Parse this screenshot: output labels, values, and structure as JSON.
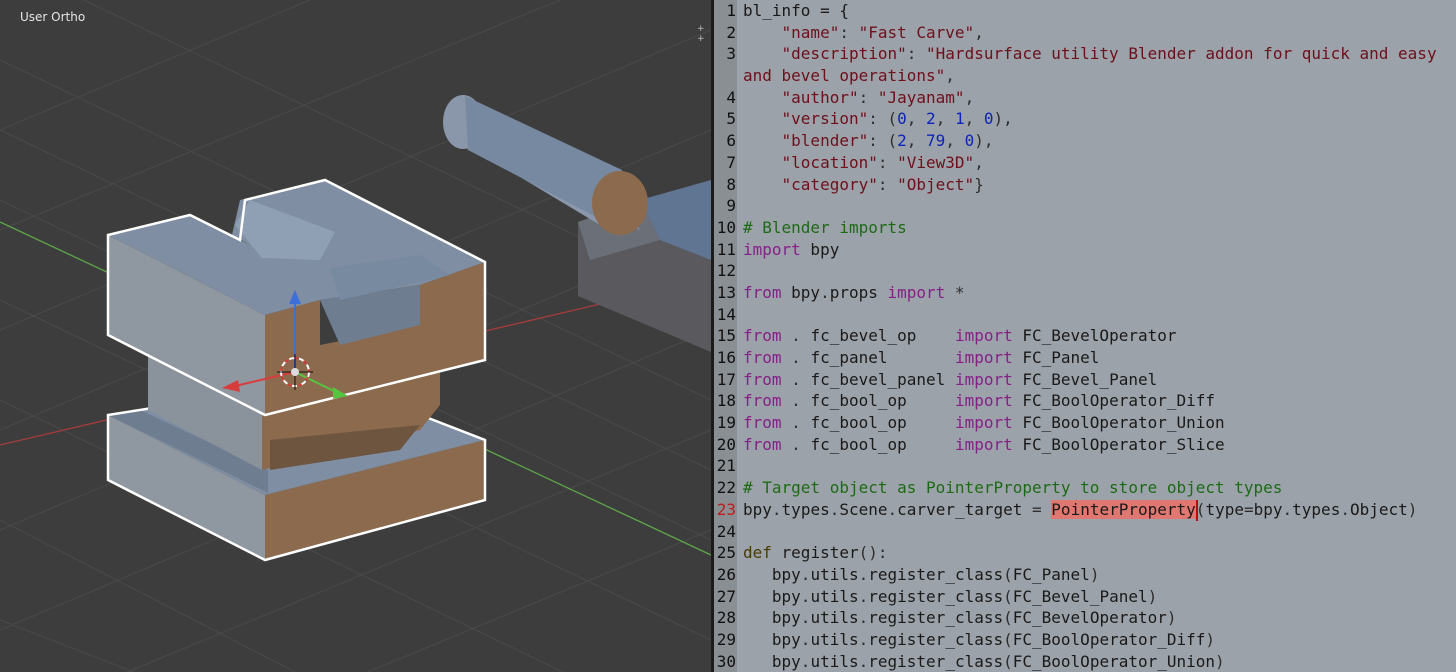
{
  "viewport": {
    "view_label": "User Ortho",
    "split_corner_icons": "+ +",
    "colors": {
      "background": "#3d3d3d",
      "grid": "#4a4a4a",
      "x_axis": "#a53c3c",
      "y_axis": "#5ea64a",
      "selection_outline": "#ffffff",
      "top_face": "#7f8ea3",
      "side_face": "#8c6a4d",
      "front_face": "#9aa3ad"
    }
  },
  "editor": {
    "current_line": 23,
    "lines": [
      {
        "n": "1",
        "tokens": [
          [
            "plain",
            "bl_info = {"
          ]
        ]
      },
      {
        "n": "2",
        "tokens": [
          [
            "plain",
            "    "
          ],
          [
            "str",
            "\"name\""
          ],
          [
            "op",
            ": "
          ],
          [
            "str",
            "\"Fast Carve\""
          ],
          [
            "op",
            ","
          ]
        ]
      },
      {
        "n": "3",
        "tokens": [
          [
            "plain",
            "    "
          ],
          [
            "str",
            "\"description\""
          ],
          [
            "op",
            ": "
          ],
          [
            "str",
            "\"Hardsurface utility Blender addon for quick and easy"
          ]
        ]
      },
      {
        "n": "",
        "tokens": [
          [
            "str",
            "and bevel operations\""
          ],
          [
            "op",
            ","
          ]
        ]
      },
      {
        "n": "4",
        "tokens": [
          [
            "plain",
            "    "
          ],
          [
            "str",
            "\"author\""
          ],
          [
            "op",
            ": "
          ],
          [
            "str",
            "\"Jayanam\""
          ],
          [
            "op",
            ","
          ]
        ]
      },
      {
        "n": "5",
        "tokens": [
          [
            "plain",
            "    "
          ],
          [
            "str",
            "\"version\""
          ],
          [
            "op",
            ": ("
          ],
          [
            "num",
            "0"
          ],
          [
            "op",
            ", "
          ],
          [
            "num",
            "2"
          ],
          [
            "op",
            ", "
          ],
          [
            "num",
            "1"
          ],
          [
            "op",
            ", "
          ],
          [
            "num",
            "0"
          ],
          [
            "op",
            "),"
          ]
        ]
      },
      {
        "n": "6",
        "tokens": [
          [
            "plain",
            "    "
          ],
          [
            "str",
            "\"blender\""
          ],
          [
            "op",
            ": ("
          ],
          [
            "num",
            "2"
          ],
          [
            "op",
            ", "
          ],
          [
            "num",
            "79"
          ],
          [
            "op",
            ", "
          ],
          [
            "num",
            "0"
          ],
          [
            "op",
            "),"
          ]
        ]
      },
      {
        "n": "7",
        "tokens": [
          [
            "plain",
            "    "
          ],
          [
            "str",
            "\"location\""
          ],
          [
            "op",
            ": "
          ],
          [
            "str",
            "\"View3D\""
          ],
          [
            "op",
            ","
          ]
        ]
      },
      {
        "n": "8",
        "tokens": [
          [
            "plain",
            "    "
          ],
          [
            "str",
            "\"category\""
          ],
          [
            "op",
            ": "
          ],
          [
            "str",
            "\"Object\""
          ],
          [
            "op",
            "}"
          ]
        ]
      },
      {
        "n": "9",
        "tokens": []
      },
      {
        "n": "10",
        "tokens": [
          [
            "cmt",
            "# Blender imports"
          ]
        ]
      },
      {
        "n": "11",
        "tokens": [
          [
            "kw",
            "import"
          ],
          [
            "plain",
            " bpy"
          ]
        ]
      },
      {
        "n": "12",
        "tokens": []
      },
      {
        "n": "13",
        "tokens": [
          [
            "kw",
            "from"
          ],
          [
            "plain",
            " bpy"
          ],
          [
            "op",
            "."
          ],
          [
            "plain",
            "props "
          ],
          [
            "kw",
            "import"
          ],
          [
            "op",
            " *"
          ]
        ]
      },
      {
        "n": "14",
        "tokens": []
      },
      {
        "n": "15",
        "tokens": [
          [
            "kw",
            "from"
          ],
          [
            "op",
            " . "
          ],
          [
            "plain",
            "fc_bevel_op    "
          ],
          [
            "kw",
            "import"
          ],
          [
            "plain",
            " FC_BevelOperator"
          ]
        ]
      },
      {
        "n": "16",
        "tokens": [
          [
            "kw",
            "from"
          ],
          [
            "op",
            " . "
          ],
          [
            "plain",
            "fc_panel       "
          ],
          [
            "kw",
            "import"
          ],
          [
            "plain",
            " FC_Panel"
          ]
        ]
      },
      {
        "n": "17",
        "tokens": [
          [
            "kw",
            "from"
          ],
          [
            "op",
            " . "
          ],
          [
            "plain",
            "fc_bevel_panel "
          ],
          [
            "kw",
            "import"
          ],
          [
            "plain",
            " FC_Bevel_Panel"
          ]
        ]
      },
      {
        "n": "18",
        "tokens": [
          [
            "kw",
            "from"
          ],
          [
            "op",
            " . "
          ],
          [
            "plain",
            "fc_bool_op     "
          ],
          [
            "kw",
            "import"
          ],
          [
            "plain",
            " FC_BoolOperator_Diff"
          ]
        ]
      },
      {
        "n": "19",
        "tokens": [
          [
            "kw",
            "from"
          ],
          [
            "op",
            " . "
          ],
          [
            "plain",
            "fc_bool_op     "
          ],
          [
            "kw",
            "import"
          ],
          [
            "plain",
            " FC_BoolOperator_Union"
          ]
        ]
      },
      {
        "n": "20",
        "tokens": [
          [
            "kw",
            "from"
          ],
          [
            "op",
            " . "
          ],
          [
            "plain",
            "fc_bool_op     "
          ],
          [
            "kw",
            "import"
          ],
          [
            "plain",
            " FC_BoolOperator_Slice"
          ]
        ]
      },
      {
        "n": "21",
        "tokens": []
      },
      {
        "n": "22",
        "tokens": [
          [
            "cmt",
            "# Target object as PointerProperty to store object types"
          ]
        ]
      },
      {
        "n": "23",
        "tokens": [
          [
            "plain",
            "bpy"
          ],
          [
            "op",
            "."
          ],
          [
            "plain",
            "types"
          ],
          [
            "op",
            "."
          ],
          [
            "plain",
            "Scene"
          ],
          [
            "op",
            "."
          ],
          [
            "plain",
            "carver_target "
          ],
          [
            "op",
            "= "
          ],
          [
            "hl",
            "PointerProperty"
          ],
          [
            "op",
            "("
          ],
          [
            "plain",
            "type"
          ],
          [
            "op",
            "="
          ],
          [
            "plain",
            "bpy"
          ],
          [
            "op",
            "."
          ],
          [
            "plain",
            "types"
          ],
          [
            "op",
            "."
          ],
          [
            "plain",
            "Object"
          ],
          [
            "op",
            ")"
          ]
        ]
      },
      {
        "n": "24",
        "tokens": []
      },
      {
        "n": "25",
        "tokens": [
          [
            "def",
            "def"
          ],
          [
            "plain",
            " register"
          ],
          [
            "op",
            "():"
          ]
        ]
      },
      {
        "n": "26",
        "tokens": [
          [
            "plain",
            "   bpy"
          ],
          [
            "op",
            "."
          ],
          [
            "plain",
            "utils"
          ],
          [
            "op",
            "."
          ],
          [
            "plain",
            "register_class"
          ],
          [
            "op",
            "("
          ],
          [
            "plain",
            "FC_Panel"
          ],
          [
            "op",
            ")"
          ]
        ]
      },
      {
        "n": "27",
        "tokens": [
          [
            "plain",
            "   bpy"
          ],
          [
            "op",
            "."
          ],
          [
            "plain",
            "utils"
          ],
          [
            "op",
            "."
          ],
          [
            "plain",
            "register_class"
          ],
          [
            "op",
            "("
          ],
          [
            "plain",
            "FC_Bevel_Panel"
          ],
          [
            "op",
            ")"
          ]
        ]
      },
      {
        "n": "28",
        "tokens": [
          [
            "plain",
            "   bpy"
          ],
          [
            "op",
            "."
          ],
          [
            "plain",
            "utils"
          ],
          [
            "op",
            "."
          ],
          [
            "plain",
            "register_class"
          ],
          [
            "op",
            "("
          ],
          [
            "plain",
            "FC_BevelOperator"
          ],
          [
            "op",
            ")"
          ]
        ]
      },
      {
        "n": "29",
        "tokens": [
          [
            "plain",
            "   bpy"
          ],
          [
            "op",
            "."
          ],
          [
            "plain",
            "utils"
          ],
          [
            "op",
            "."
          ],
          [
            "plain",
            "register_class"
          ],
          [
            "op",
            "("
          ],
          [
            "plain",
            "FC_BoolOperator_Diff"
          ],
          [
            "op",
            ")"
          ]
        ]
      },
      {
        "n": "30",
        "tokens": [
          [
            "plain",
            "   bpy"
          ],
          [
            "op",
            "."
          ],
          [
            "plain",
            "utils"
          ],
          [
            "op",
            "."
          ],
          [
            "plain",
            "register_class"
          ],
          [
            "op",
            "("
          ],
          [
            "plain",
            "FC_BoolOperator_Union"
          ],
          [
            "op",
            ")"
          ]
        ]
      }
    ]
  }
}
